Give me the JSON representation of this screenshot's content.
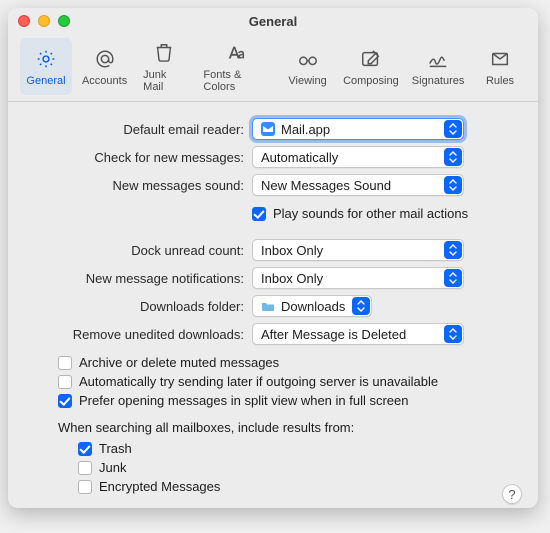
{
  "window": {
    "title": "General"
  },
  "toolbar": {
    "items": [
      {
        "label": "General"
      },
      {
        "label": "Accounts"
      },
      {
        "label": "Junk Mail"
      },
      {
        "label": "Fonts & Colors"
      },
      {
        "label": "Viewing"
      },
      {
        "label": "Composing"
      },
      {
        "label": "Signatures"
      },
      {
        "label": "Rules"
      }
    ]
  },
  "labels": {
    "default_reader": "Default email reader:",
    "check_messages": "Check for new messages:",
    "new_sound": "New messages sound:",
    "play_sounds": "Play sounds for other mail actions",
    "dock_unread": "Dock unread count:",
    "notifications": "New message notifications:",
    "downloads_folder": "Downloads folder:",
    "remove_downloads": "Remove unedited downloads:",
    "archive_muted": "Archive or delete muted messages",
    "auto_retry": "Automatically try sending later if outgoing server is unavailable",
    "split_view": "Prefer opening messages in split view when in full screen",
    "search_header": "When searching all mailboxes, include results from:",
    "trash": "Trash",
    "junk": "Junk",
    "encrypted": "Encrypted Messages"
  },
  "values": {
    "default_reader": "Mail.app",
    "check_messages": "Automatically",
    "new_sound": "New Messages Sound",
    "dock_unread": "Inbox Only",
    "notifications": "Inbox Only",
    "downloads_folder": "Downloads",
    "remove_downloads": "After Message is Deleted"
  },
  "checks": {
    "play_sounds": true,
    "archive_muted": false,
    "auto_retry": false,
    "split_view": true,
    "trash": true,
    "junk": false,
    "encrypted": false
  },
  "help": "?"
}
